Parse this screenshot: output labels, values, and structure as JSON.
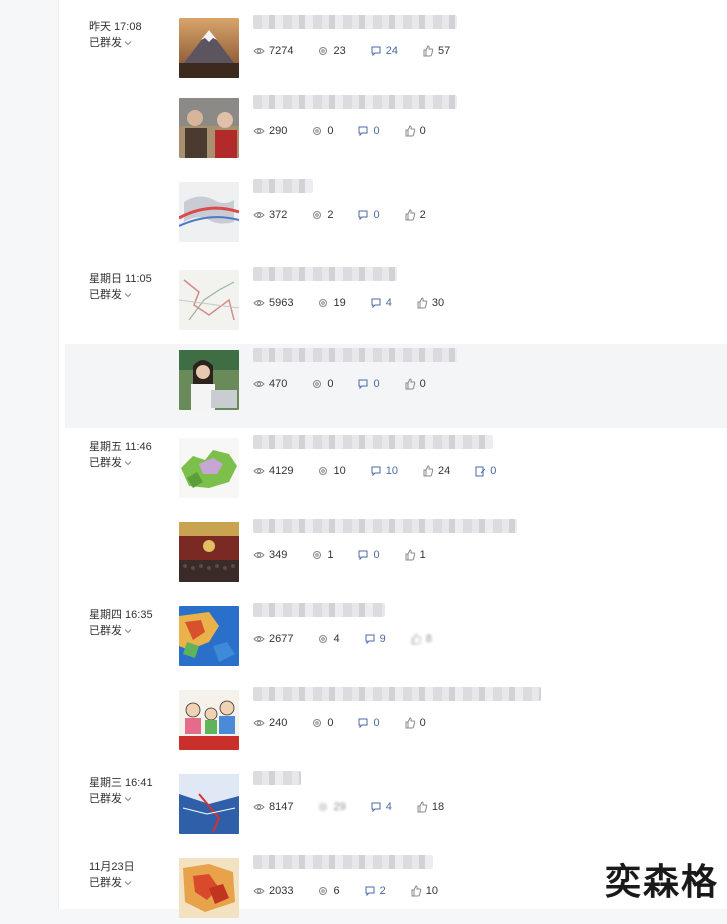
{
  "groups": [
    {
      "date": "昨天 17:08",
      "status": "已群发",
      "posts": [
        {
          "thumb": "mountain-sunset",
          "views": "7274",
          "shares": "23",
          "comments": "24",
          "likes": "57"
        },
        {
          "thumb": "couple-portrait",
          "views": "290",
          "shares": "0",
          "comments": "0",
          "likes": "0"
        },
        {
          "thumb": "world-map",
          "views": "372",
          "shares": "2",
          "comments": "0",
          "likes": "2"
        }
      ]
    },
    {
      "date": "星期日 11:05",
      "status": "已群发",
      "posts": [
        {
          "thumb": "route-map",
          "views": "5963",
          "shares": "19",
          "comments": "4",
          "likes": "30"
        },
        {
          "thumb": "woman-laptop",
          "views": "470",
          "shares": "0",
          "comments": "0",
          "likes": "0"
        }
      ]
    },
    {
      "date": "星期五 11:46",
      "status": "已群发",
      "posts": [
        {
          "thumb": "region-map",
          "views": "4129",
          "shares": "10",
          "comments": "10",
          "likes": "24",
          "extra": "0"
        },
        {
          "thumb": "assembly-hall",
          "views": "349",
          "shares": "1",
          "comments": "0",
          "likes": "1"
        }
      ]
    },
    {
      "date": "星期四 16:35",
      "status": "已群发",
      "posts": [
        {
          "thumb": "weather-map",
          "views": "2677",
          "shares": "4",
          "comments": "9",
          "likes": "8"
        },
        {
          "thumb": "family-cartoon",
          "views": "240",
          "shares": "0",
          "comments": "0",
          "likes": "0"
        }
      ]
    },
    {
      "date": "星期三 16:41",
      "status": "已群发",
      "posts": [
        {
          "thumb": "satellite-map",
          "views": "8147",
          "shares": "29",
          "comments": "4",
          "likes": "18"
        }
      ]
    },
    {
      "date": "11月23日",
      "status": "已群发",
      "posts": [
        {
          "thumb": "heat-map",
          "views": "2033",
          "shares": "6",
          "comments": "2",
          "likes": "10"
        }
      ]
    }
  ],
  "watermark": "奕森格",
  "colors": {
    "accent": "#4a6aa5",
    "highlight": "#f4f5f7"
  }
}
